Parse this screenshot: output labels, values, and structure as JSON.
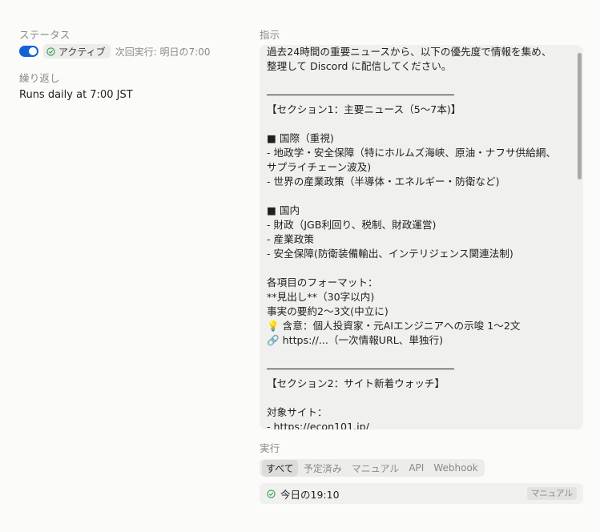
{
  "status": {
    "label": "ステータス",
    "badge": "アクティブ",
    "next_run": "次回実行: 明日の7:00"
  },
  "repeat": {
    "label": "繰り返し",
    "value": "Runs daily at 7:00 JST"
  },
  "instructions": {
    "label": "指示",
    "lines": [
      "過去24時間の重要ニュースから、以下の優先度で情報を集め、",
      "整理して Discord に配信してください。",
      "",
      "---",
      "【セクション1：主要ニュース（5〜7本)】",
      "",
      "■ 国際（重視)",
      "- 地政学・安全保障（特にホルムズ海峡、原油・ナフサ供給網、",
      "サプライチェーン波及)",
      "- 世界の産業政策（半導体・エネルギー・防衛など)",
      "",
      "■ 国内",
      "- 財政（JGB利回り、税制、財政運営)",
      "- 産業政策",
      "- 安全保障(防衛装備輸出、インテリジェンス関連法制)",
      "",
      "各項目のフォーマット：",
      "**見出し**（30字以内)",
      "事実の要約2〜3文(中立に)",
      "💡 含意：個人投資家・元AIエンジニアへの示唆 1〜2文",
      "🔗 https://...（一次情報URL、単独行)",
      "",
      "---",
      "【セクション2：サイト新着ウォッチ】",
      "",
      "対象サイト：",
      "- https://econ101.jp/"
    ]
  },
  "runs": {
    "label": "実行",
    "tabs": [
      "すべて",
      "予定済み",
      "マニュアル",
      "API",
      "Webhook"
    ],
    "active_tab": "すべて",
    "items": [
      {
        "time": "今日の19:10",
        "type": "マニュアル"
      }
    ]
  },
  "colors": {
    "accent": "#1463d6",
    "success": "#2e9d4b"
  }
}
